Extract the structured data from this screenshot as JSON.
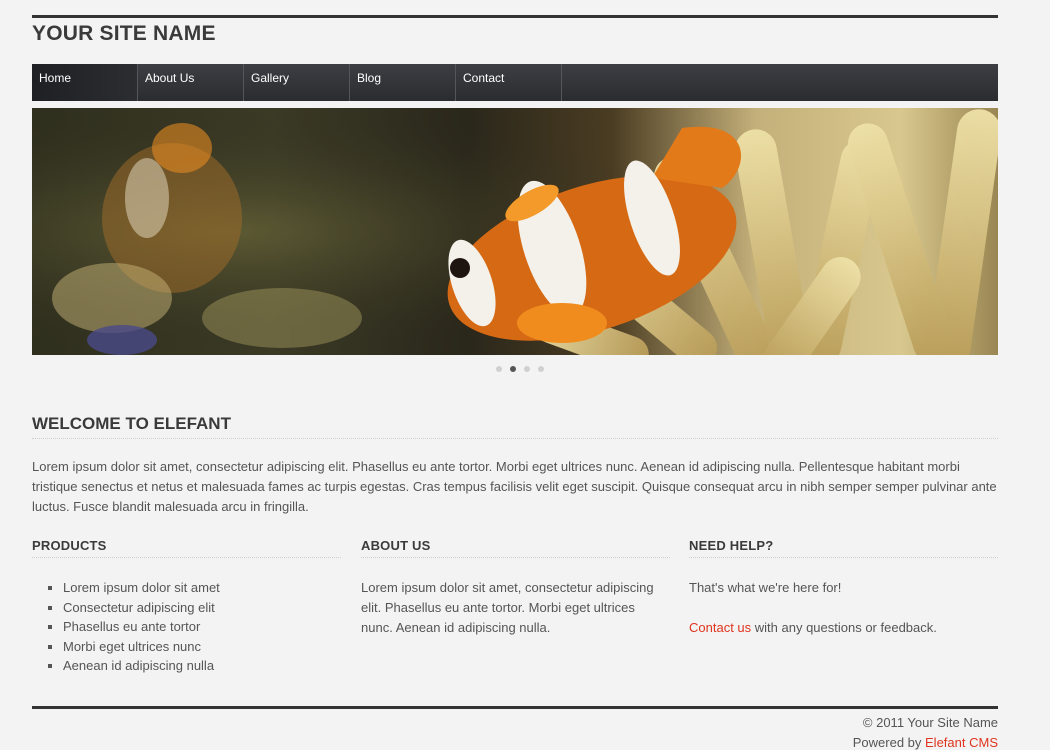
{
  "site": {
    "title": "YOUR SITE NAME"
  },
  "nav": {
    "items": [
      {
        "label": "Home"
      },
      {
        "label": "About Us"
      },
      {
        "label": "Gallery"
      },
      {
        "label": "Blog"
      },
      {
        "label": "Contact"
      }
    ],
    "active_index": 0
  },
  "slider": {
    "slide_count": 4,
    "active_index": 1
  },
  "welcome": {
    "heading": "WELCOME TO ELEFANT",
    "text": "Lorem ipsum dolor sit amet, consectetur adipiscing elit. Phasellus eu ante tortor. Morbi eget ultrices nunc. Aenean id adipiscing nulla. Pellentesque habitant morbi tristique senectus et netus et malesuada fames ac turpis egestas. Cras tempus facilisis velit eget suscipit. Quisque consequat arcu in nibh semper semper pulvinar ante luctus. Fusce blandit malesuada arcu in fringilla."
  },
  "products": {
    "heading": "PRODUCTS",
    "items": [
      "Lorem ipsum dolor sit amet",
      "Consectetur adipiscing elit",
      "Phasellus eu ante tortor",
      "Morbi eget ultrices nunc",
      "Aenean id adipiscing nulla"
    ]
  },
  "about": {
    "heading": "ABOUT US",
    "text": "Lorem ipsum dolor sit amet, consectetur adipiscing elit. Phasellus eu ante tortor. Morbi eget ultrices nunc. Aenean id adipiscing nulla."
  },
  "help": {
    "heading": "NEED HELP?",
    "line1": "That's what we're here for!",
    "contact_link": "Contact us",
    "contact_rest": " with any questions or feedback."
  },
  "footer": {
    "copyright": "© 2011 Your Site Name",
    "powered_prefix": "Powered by ",
    "powered_link": "Elefant CMS"
  },
  "colors": {
    "accent": "#e0341e",
    "nav_bg": "#2b2c30",
    "rule": "#333333"
  }
}
